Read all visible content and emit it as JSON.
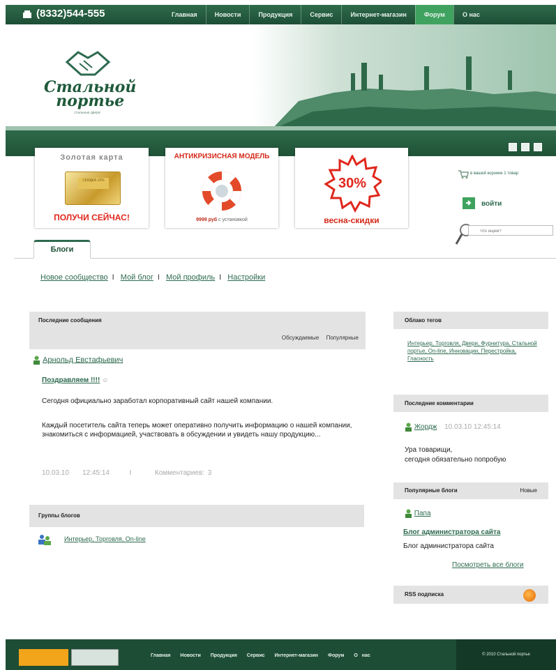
{
  "topbar": {
    "phone": "(8332)544-555",
    "nav": [
      "Главная",
      "Новости",
      "Продукция",
      "Сервис",
      "Интернет-магазин",
      "Форум",
      "О нас"
    ],
    "active": "Форум"
  },
  "logo": {
    "line1": "Стальной",
    "line2": "портье",
    "tagline": "стальные двери"
  },
  "banners": {
    "b1_title": "Золотая карта",
    "b1_card": "СКИДКА 10%",
    "b1_cta": "ПОЛУЧИ СЕЙЧАС!",
    "b2_title": "АНТИКРИЗИСНАЯ МОДЕЛЬ",
    "b2_price": "9999 руб",
    "b2_price_suffix": " с установкой",
    "b3_percent": "30%",
    "b3_caption": "весна-скидки"
  },
  "widgets": {
    "cart": "в вашей корзине 1 товар",
    "login": "войти",
    "search_placeholder": "Что ищем?"
  },
  "tab": "Блоги",
  "subnav": [
    "Новое сообщество",
    "Мой блог",
    "Мой профиль",
    "Настройки"
  ],
  "posts": {
    "header": "Последние сообщения",
    "filter_discussed": "Обсуждаемые",
    "filter_popular": "Популярные",
    "author": "Арнольд Евстафьевич",
    "title": "Поздравляем !!!!",
    "title_icon": "☺",
    "body1": "Сегодня официально заработал корпоративный сайт нашей компании.",
    "body2": "Каждый посетитель сайта теперь может оперативно получить информацию о нашей компании, знакомиться с информацией, участвовать в обсуждении и увидеть нашу продукцию...",
    "date": "10.03.10",
    "time": "12:45:14",
    "sep": "I",
    "comments": "Комментариев: 3"
  },
  "groups": {
    "header": "Группы блогов",
    "link": "Интерьер, Торговля, On-line"
  },
  "sidebar": {
    "tags_header": "Облако тегов",
    "tags": "Интерьер, Торговля, Двери, Фурнитура, Стальной портье, On-line, Инновации, Перестройка, Гласность",
    "comments_header": "Последние комментарии",
    "c_author": "Жордж",
    "c_date": "10.03.10 12:45:14",
    "c_line1": "Ура товарищи,",
    "c_line2": "сегодня обязательно попробую",
    "blogs_header": "Популярные блоги",
    "blogs_new": "Новые",
    "b_user": "Папа",
    "b_name": "Блог администратора сайта",
    "b_desc": "Блог администратора сайта",
    "all_blogs": "Посмотреть все блоги",
    "rss": "RSS подписка"
  },
  "footer": {
    "nav": [
      "Главная",
      "Новости",
      "Продукция",
      "Сервис",
      "Интернет-магазин",
      "Форум",
      "О нас"
    ],
    "copyright": "© 2010 Стальной портье"
  },
  "colors": {
    "brand_green": "#1d4e35",
    "accent_green": "#3fa35f",
    "link_green": "#2d6a4f",
    "promo_red": "#d42a1a"
  }
}
